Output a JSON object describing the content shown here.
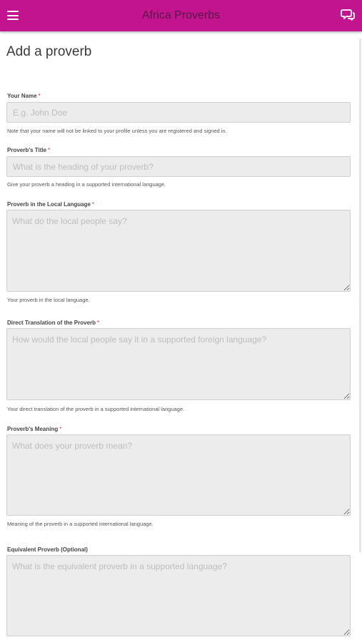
{
  "header": {
    "title": "Africa Proverbs"
  },
  "page": {
    "title": "Add a proverb"
  },
  "required_mark": "*",
  "fields": {
    "name": {
      "label": "Your Name",
      "placeholder": "E.g. John Doe",
      "help": "Note that your name will not be linked to your profile unless you are registered and signed in."
    },
    "title": {
      "label": "Proverb's Title",
      "placeholder": "What is the heading of your proverb?",
      "help": "Give your proverb a heading in a supported international language."
    },
    "local": {
      "label": "Proverb in the Local Language",
      "placeholder": "What do the local people say?",
      "help": "Your proverb in the local language."
    },
    "translation": {
      "label": "Direct Translation of the Proverb",
      "placeholder": "How would the local people say it in a supported foreign language?",
      "help": "Your direct translation of the proverb in a supported international language."
    },
    "meaning": {
      "label": "Proverb's Meaning",
      "placeholder": "What does your proverb mean?",
      "help": "Meaning of the proverb in a supported international language."
    },
    "equivalent": {
      "label": "Equivalent Proverb (Optional)",
      "placeholder": "What is the equivalent proverb in a supported language?"
    }
  },
  "icons": {
    "menu": "menu-icon",
    "chat": "chat-icon"
  },
  "colors": {
    "header_bg": "#c2148f",
    "field_bg": "#ececec",
    "required": "#d0302a"
  }
}
